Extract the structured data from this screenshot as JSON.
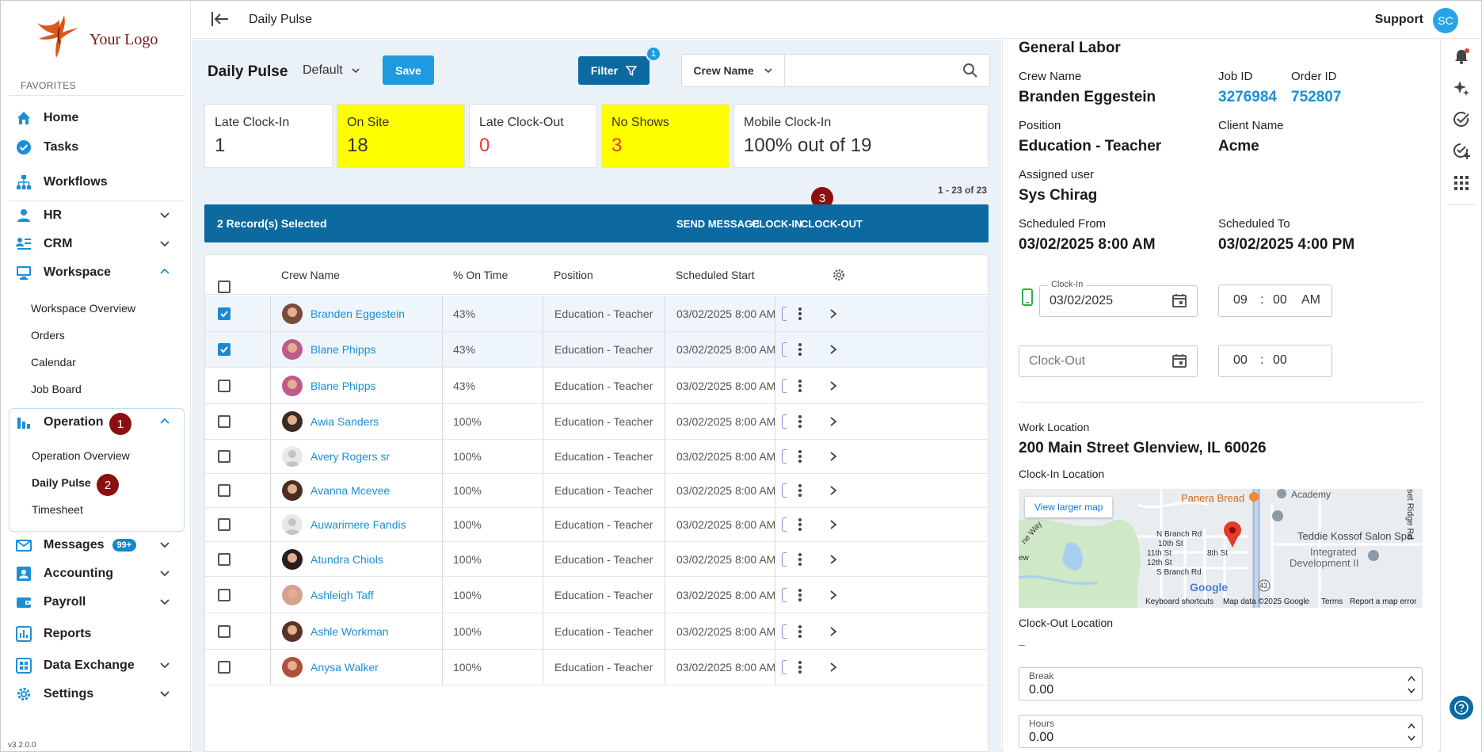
{
  "brand": {
    "logo_text": "Your Logo",
    "version": "v3.2.0.0"
  },
  "header": {
    "crumb": "Daily Pulse",
    "support": "Support",
    "avatar_initials": "SC"
  },
  "sidebar": {
    "favorites_label": "FAVORITES",
    "items": [
      {
        "label": "Home",
        "icon": "home-icon"
      },
      {
        "label": "Tasks",
        "icon": "check-circle-icon"
      },
      {
        "label": "Workflows",
        "icon": "hierarchy-icon"
      },
      {
        "label": "HR",
        "icon": "person-icon"
      },
      {
        "label": "CRM",
        "icon": "contact-list-icon"
      },
      {
        "label": "Workspace",
        "icon": "monitor-icon"
      },
      {
        "label": "Operation",
        "icon": "bar-chart-icon"
      },
      {
        "label": "Messages",
        "icon": "mail-icon",
        "badge": "99+"
      },
      {
        "label": "Accounting",
        "icon": "accounting-icon"
      },
      {
        "label": "Payroll",
        "icon": "payroll-icon"
      },
      {
        "label": "Reports",
        "icon": "reports-icon"
      },
      {
        "label": "Data Exchange",
        "icon": "data-exchange-icon"
      },
      {
        "label": "Settings",
        "icon": "gear-icon"
      }
    ],
    "workspace_sub": [
      "Workspace Overview",
      "Orders",
      "Calendar",
      "Job Board"
    ],
    "operation_sub": [
      "Operation Overview",
      "Daily Pulse",
      "Timesheet"
    ],
    "callouts": {
      "operation": "1",
      "daily_pulse": "2"
    }
  },
  "main": {
    "title": "Daily Pulse",
    "view": "Default",
    "save_label": "Save",
    "filter_label": "Filter",
    "filter_count": "1",
    "search": {
      "field": "Crew Name",
      "placeholder": ""
    },
    "stats": [
      {
        "label": "Late Clock-In",
        "value": "1",
        "highlight": false,
        "red": false
      },
      {
        "label": "On Site",
        "value": "18",
        "highlight": true,
        "red": false
      },
      {
        "label": "Late Clock-Out",
        "value": "0",
        "highlight": false,
        "red": true
      },
      {
        "label": "No Shows",
        "value": "3",
        "highlight": true,
        "red": true
      },
      {
        "label": "Mobile Clock-In",
        "value": "100% out of 19",
        "highlight": false,
        "red": false
      }
    ],
    "paging": "1 - 23 of 23",
    "selection": {
      "count_text": "2 Record(s) Selected",
      "send_message": "SEND MESSAGE",
      "clock_in": "CLOCK-IN",
      "clock_out": "CLOCK-OUT",
      "callout": "3"
    },
    "columns": {
      "crew": "Crew Name",
      "ontime": "% On Time",
      "position": "Position",
      "start": "Scheduled Start"
    },
    "rows": [
      {
        "name": "Branden Eggestein",
        "ontime": "43%",
        "position": "Education - Teacher",
        "start": "03/02/2025 8:00 AM",
        "checked": true,
        "avatar": "#7a4a3a"
      },
      {
        "name": "Blane Phipps",
        "ontime": "43%",
        "position": "Education - Teacher",
        "start": "03/02/2025 8:00 AM",
        "checked": true,
        "avatar": "#c05a8a"
      },
      {
        "name": "Blane Phipps",
        "ontime": "43%",
        "position": "Education - Teacher",
        "start": "03/02/2025 8:00 AM",
        "checked": false,
        "avatar": "#c05a8a"
      },
      {
        "name": "Awia Sanders",
        "ontime": "100%",
        "position": "Education - Teacher",
        "start": "03/02/2025 8:00 AM",
        "checked": false,
        "avatar": "#3a2a22"
      },
      {
        "name": "Avery Rogers sr",
        "ontime": "100%",
        "position": "Education - Teacher",
        "start": "03/02/2025 8:00 AM",
        "checked": false,
        "avatar": ""
      },
      {
        "name": "Avanna Mcevee",
        "ontime": "100%",
        "position": "Education - Teacher",
        "start": "03/02/2025 8:00 AM",
        "checked": false,
        "avatar": "#4a2e22"
      },
      {
        "name": "Auwarimere Fandis",
        "ontime": "100%",
        "position": "Education - Teacher",
        "start": "03/02/2025 8:00 AM",
        "checked": false,
        "avatar": ""
      },
      {
        "name": "Atundra Chiols",
        "ontime": "100%",
        "position": "Education - Teacher",
        "start": "03/02/2025 8:00 AM",
        "checked": false,
        "avatar": "#2a1e1a"
      },
      {
        "name": "Ashleigh Taff",
        "ontime": "100%",
        "position": "Education - Teacher",
        "start": "03/02/2025 8:00 AM",
        "checked": false,
        "avatar": "#d8a090"
      },
      {
        "name": "Ashle Workman",
        "ontime": "100%",
        "position": "Education - Teacher",
        "start": "03/02/2025 8:00 AM",
        "checked": false,
        "avatar": "#5a3326"
      },
      {
        "name": "Anysa Walker",
        "ontime": "100%",
        "position": "Education - Teacher",
        "start": "03/02/2025 8:00 AM",
        "checked": false,
        "avatar": "#b0503a"
      }
    ]
  },
  "detail": {
    "title": "General Labor",
    "crew_name_label": "Crew Name",
    "crew_name": "Branden Eggestein",
    "job_id_label": "Job ID",
    "job_id": "3276984",
    "order_id_label": "Order ID",
    "order_id": "752807",
    "position_label": "Position",
    "position": "Education - Teacher",
    "client_label": "Client Name",
    "client": "Acme",
    "assigned_label": "Assigned user",
    "assigned": "Sys Chirag",
    "from_label": "Scheduled From",
    "from": "03/02/2025 8:00 AM",
    "to_label": "Scheduled To",
    "to": "03/02/2025 4:00 PM",
    "clock_in_label": "Clock-In",
    "clock_in_date": "03/02/2025",
    "clock_in_hh": "09",
    "clock_in_mm": "00",
    "clock_in_ampm": "AM",
    "clock_out_placeholder": "Clock-Out",
    "clock_out_hh": "00",
    "clock_out_mm": "00",
    "work_location_label": "Work Location",
    "work_location": "200 Main Street Glenview, IL 60026",
    "clockin_location_label": "Clock-In Location",
    "map": {
      "larger_map": "View larger map",
      "labels": [
        "Panera Bread",
        "Academy",
        "Teddie Kossof Salon Spa",
        "Integrated",
        "Development II",
        "N Branch Rd",
        "S Branch Rd",
        "10th St",
        "11th St",
        "12th St",
        "8th St",
        "set Ridge Rd",
        "ne Way",
        "ew",
        "43"
      ],
      "google": "Google",
      "footer": [
        "Keyboard shortcuts",
        "Map data ©2025 Google",
        "Terms",
        "Report a map error"
      ]
    },
    "clockout_location_label": "Clock-Out Location",
    "clockout_location": "–",
    "break_label": "Break",
    "break": "0.00",
    "hours_label": "Hours",
    "hours": "0.00"
  },
  "colors": {
    "primary": "#0d6aa1",
    "accent": "#1e9be0",
    "highlight": "#ffff00",
    "alert": "#e53b2c",
    "callout": "#8a1010"
  }
}
